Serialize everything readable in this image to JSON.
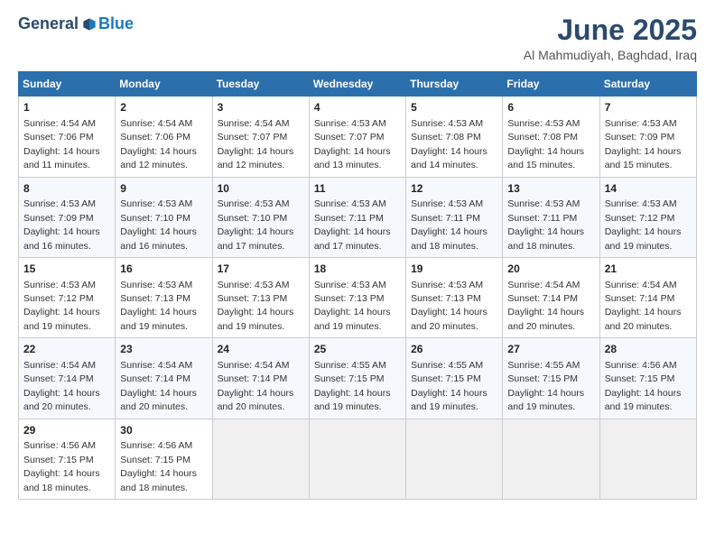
{
  "logo": {
    "general": "General",
    "blue": "Blue"
  },
  "header": {
    "title": "June 2025",
    "subtitle": "Al Mahmudiyah, Baghdad, Iraq"
  },
  "calendar": {
    "days_of_week": [
      "Sunday",
      "Monday",
      "Tuesday",
      "Wednesday",
      "Thursday",
      "Friday",
      "Saturday"
    ],
    "weeks": [
      [
        null,
        {
          "day": 2,
          "sunrise": "4:54 AM",
          "sunset": "7:06 PM",
          "daylight": "14 hours and 12 minutes."
        },
        {
          "day": 3,
          "sunrise": "4:54 AM",
          "sunset": "7:07 PM",
          "daylight": "14 hours and 12 minutes."
        },
        {
          "day": 4,
          "sunrise": "4:53 AM",
          "sunset": "7:07 PM",
          "daylight": "14 hours and 13 minutes."
        },
        {
          "day": 5,
          "sunrise": "4:53 AM",
          "sunset": "7:08 PM",
          "daylight": "14 hours and 14 minutes."
        },
        {
          "day": 6,
          "sunrise": "4:53 AM",
          "sunset": "7:08 PM",
          "daylight": "14 hours and 15 minutes."
        },
        {
          "day": 7,
          "sunrise": "4:53 AM",
          "sunset": "7:09 PM",
          "daylight": "14 hours and 15 minutes."
        }
      ],
      [
        {
          "day": 1,
          "sunrise": "4:54 AM",
          "sunset": "7:06 PM",
          "daylight": "14 hours and 11 minutes."
        },
        {
          "day": 8,
          "sunrise": "4:53 AM",
          "sunset": "7:09 PM",
          "daylight": "14 hours and 16 minutes."
        },
        {
          "day": 9,
          "sunrise": "4:53 AM",
          "sunset": "7:10 PM",
          "daylight": "14 hours and 16 minutes."
        },
        {
          "day": 10,
          "sunrise": "4:53 AM",
          "sunset": "7:10 PM",
          "daylight": "14 hours and 17 minutes."
        },
        {
          "day": 11,
          "sunrise": "4:53 AM",
          "sunset": "7:11 PM",
          "daylight": "14 hours and 17 minutes."
        },
        {
          "day": 12,
          "sunrise": "4:53 AM",
          "sunset": "7:11 PM",
          "daylight": "14 hours and 18 minutes."
        },
        {
          "day": 13,
          "sunrise": "4:53 AM",
          "sunset": "7:11 PM",
          "daylight": "14 hours and 18 minutes."
        },
        {
          "day": 14,
          "sunrise": "4:53 AM",
          "sunset": "7:12 PM",
          "daylight": "14 hours and 19 minutes."
        }
      ],
      [
        {
          "day": 15,
          "sunrise": "4:53 AM",
          "sunset": "7:12 PM",
          "daylight": "14 hours and 19 minutes."
        },
        {
          "day": 16,
          "sunrise": "4:53 AM",
          "sunset": "7:13 PM",
          "daylight": "14 hours and 19 minutes."
        },
        {
          "day": 17,
          "sunrise": "4:53 AM",
          "sunset": "7:13 PM",
          "daylight": "14 hours and 19 minutes."
        },
        {
          "day": 18,
          "sunrise": "4:53 AM",
          "sunset": "7:13 PM",
          "daylight": "14 hours and 19 minutes."
        },
        {
          "day": 19,
          "sunrise": "4:53 AM",
          "sunset": "7:13 PM",
          "daylight": "14 hours and 20 minutes."
        },
        {
          "day": 20,
          "sunrise": "4:54 AM",
          "sunset": "7:14 PM",
          "daylight": "14 hours and 20 minutes."
        },
        {
          "day": 21,
          "sunrise": "4:54 AM",
          "sunset": "7:14 PM",
          "daylight": "14 hours and 20 minutes."
        }
      ],
      [
        {
          "day": 22,
          "sunrise": "4:54 AM",
          "sunset": "7:14 PM",
          "daylight": "14 hours and 20 minutes."
        },
        {
          "day": 23,
          "sunrise": "4:54 AM",
          "sunset": "7:14 PM",
          "daylight": "14 hours and 20 minutes."
        },
        {
          "day": 24,
          "sunrise": "4:54 AM",
          "sunset": "7:14 PM",
          "daylight": "14 hours and 20 minutes."
        },
        {
          "day": 25,
          "sunrise": "4:55 AM",
          "sunset": "7:15 PM",
          "daylight": "14 hours and 19 minutes."
        },
        {
          "day": 26,
          "sunrise": "4:55 AM",
          "sunset": "7:15 PM",
          "daylight": "14 hours and 19 minutes."
        },
        {
          "day": 27,
          "sunrise": "4:55 AM",
          "sunset": "7:15 PM",
          "daylight": "14 hours and 19 minutes."
        },
        {
          "day": 28,
          "sunrise": "4:56 AM",
          "sunset": "7:15 PM",
          "daylight": "14 hours and 19 minutes."
        }
      ],
      [
        {
          "day": 29,
          "sunrise": "4:56 AM",
          "sunset": "7:15 PM",
          "daylight": "14 hours and 18 minutes."
        },
        {
          "day": 30,
          "sunrise": "4:56 AM",
          "sunset": "7:15 PM",
          "daylight": "14 hours and 18 minutes."
        },
        null,
        null,
        null,
        null,
        null
      ]
    ]
  }
}
